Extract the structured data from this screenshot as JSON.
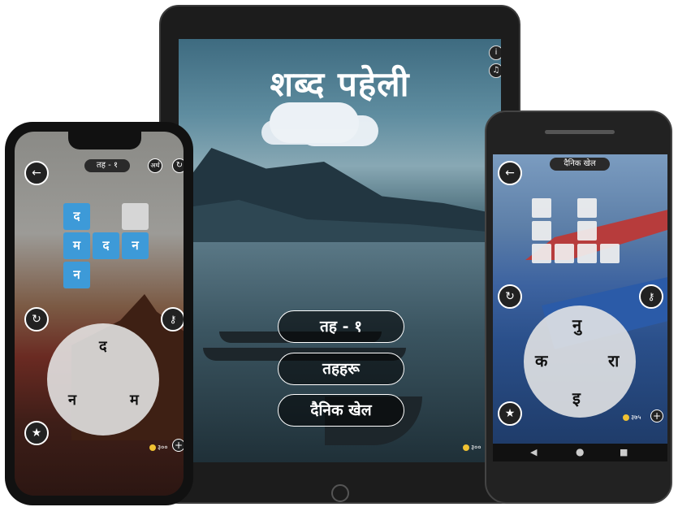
{
  "tablet": {
    "title": "शब्द पहेली",
    "buttons": [
      "तह - १",
      "तहहरू",
      "दैनिक खेल"
    ],
    "info_icon": "i",
    "sound_icon": "speaker",
    "coins": "३००"
  },
  "iphone": {
    "level": "तह - १",
    "meaning_label": "अर्थ",
    "tiles": [
      "द",
      "म",
      "द",
      "न",
      "न"
    ],
    "wheel_letters": [
      "द",
      "न",
      "म"
    ],
    "coins": "३००",
    "hint_sub": "५०"
  },
  "android": {
    "title": "दैनिक खेल",
    "wheel_letters": [
      "नु",
      "क",
      "रा",
      "इ"
    ],
    "coins": "३७५",
    "hint_sub": "५०"
  },
  "colors": {
    "tile_blue": "#3d9ad8",
    "button_border": "#ffffff"
  }
}
